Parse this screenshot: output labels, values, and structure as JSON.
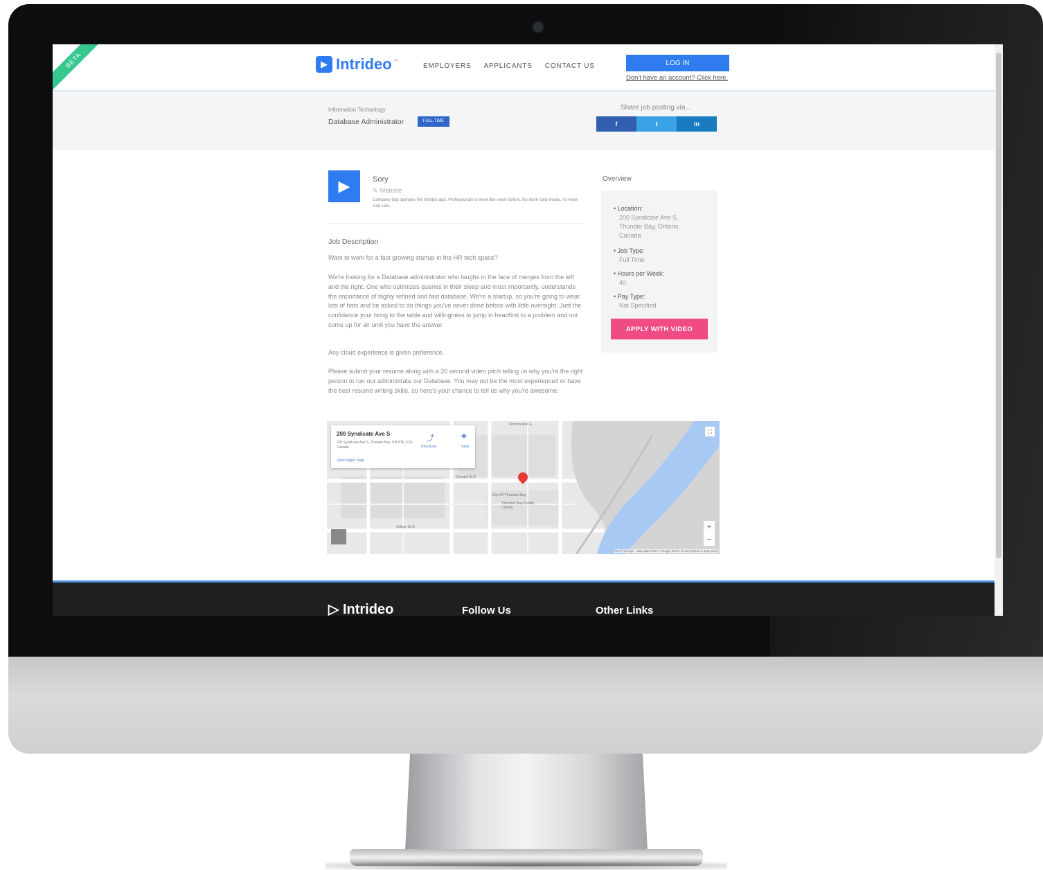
{
  "header": {
    "beta": "BETA",
    "logo": "Intrideo",
    "logo_tm": "™",
    "nav": [
      "EMPLOYERS",
      "APPLICANTS",
      "CONTACT US"
    ],
    "login": "LOG IN",
    "signup": "Don't have an account? Click here."
  },
  "job": {
    "category": "Information Technology",
    "title": "Database Administrator",
    "type_badge": "FULL TIME",
    "share_label": "Share job posting via...",
    "share": [
      "f",
      "t",
      "in"
    ]
  },
  "company": {
    "name": "Sory",
    "website": "Website",
    "blurb": "Company that operates the Intrideo app. Professionals to meet like never before. No more cold emails, no more cold calls."
  },
  "description": {
    "heading": "Job Description",
    "paragraphs": [
      "Want to work for a fast growing startup in the HR tech space?",
      "We're looking for a Database administrator who laughs in the face of merges from the left and the right. One who optimizes queries in their sleep and most importantly, understands the importance of highly refined and fast database. We're a startup, so you're going to wear lots of hats and be asked to do things you've never done before with little oversight. Just the confidence your bring to the table and willingness to jump in headfirst to a problem and not come up for air until you have the answer.",
      "Any cloud experience is given preference.",
      "Please submit your resume along with a 20 second video pitch telling us why you're the right person to run our administrate our Database. You may not be the most experienced or have the best resume writing skills, so here's your chance to tell us why you're awesome."
    ]
  },
  "overview": {
    "label": "Overview",
    "location_label": "Location:",
    "location_value": "200 Syndicate Ave S, Thunder Bay, Ontario, Canada",
    "jobtype_label": "Job Type:",
    "jobtype_value": "Full Time",
    "hours_label": "Hours per Week:",
    "hours_value": "40",
    "paytype_label": "Pay Type:",
    "paytype_value": "Not Specified",
    "apply": "APPLY WITH VIDEO"
  },
  "map": {
    "title": "200 Syndicate Ave S",
    "address": "200 Syndicate Ave S, Thunder Bay, ON P7E 1C9, Canada",
    "larger": "View larger map",
    "directions": "Directions",
    "save": "Save",
    "labels": [
      "Victoria Ave E",
      "Arthur St E",
      "City Of Thunder Bay",
      "Thunder Bay Public Library",
      "Donald St E"
    ],
    "credit": "©2017 Google · Map data ©2017 Google   Terms of Use   Report a map error"
  },
  "footer": {
    "logo": "Intrideo",
    "follow": "Follow Us",
    "other": "Other Links"
  },
  "colors": {
    "brand": "#2f7cf0",
    "apply": "#ef4b85",
    "facebook": "#2f5fae",
    "twitter": "#3aa3e6",
    "linkedin": "#1a7ac0"
  }
}
